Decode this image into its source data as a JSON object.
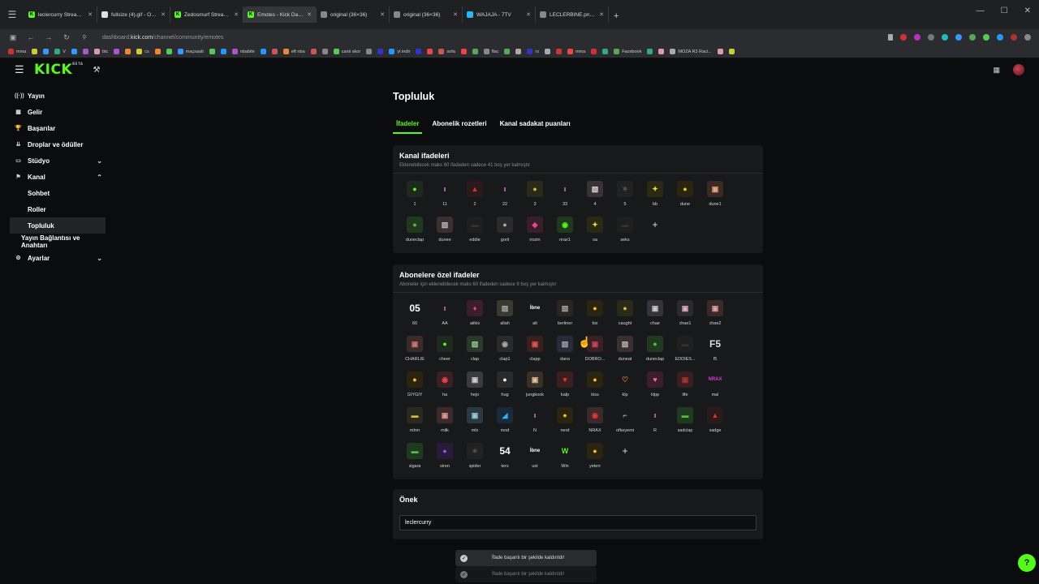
{
  "browser": {
    "tabs": [
      {
        "label": "leclercurry Stream - Watch",
        "fav": "K",
        "color": "#53fc18",
        "active": false
      },
      {
        "label": "fullsize (4).gif - Online GIF...",
        "fav": "",
        "color": "#e0e0e0",
        "active": false
      },
      {
        "label": "Zedosmurf Stream - Watch",
        "fav": "K",
        "color": "#53fc18",
        "active": false
      },
      {
        "label": "Emotes - Kick Dashboard",
        "fav": "K",
        "color": "#53fc18",
        "active": true
      },
      {
        "label": "original (36×36)",
        "fav": "",
        "color": "#888888",
        "active": false
      },
      {
        "label": "original (36×36)",
        "fav": "",
        "color": "#888888",
        "active": false
      },
      {
        "label": "WAJAJA - 7TV",
        "fav": "",
        "color": "#29b6f6",
        "active": false
      },
      {
        "label": "LECLERBINE.png (32×32)",
        "fav": "",
        "color": "#888888",
        "active": false
      }
    ],
    "url_prefix": "dashboard.",
    "url_domain": "kick.com",
    "url_path": "/channel/community/emotes",
    "bookmarks": [
      "mma",
      "V",
      "btc",
      "cs",
      "maçsaati",
      "nbabite",
      "eft nba",
      "canlı skor",
      "yt indir",
      "sofa",
      "flac",
      "rs",
      "mma",
      "Facebook",
      "MOZA R3 Raci..."
    ]
  },
  "header": {
    "logo": "KICK",
    "logo_badge": "BETA"
  },
  "sidebar": {
    "items": [
      {
        "label": "Yayın",
        "icon": "((·))"
      },
      {
        "label": "Gelir",
        "icon": "▦"
      },
      {
        "label": "Başarılar",
        "icon": "🏆"
      },
      {
        "label": "Droplar ve ödüller",
        "icon": "⇊"
      },
      {
        "label": "Stüdyo",
        "icon": "▭"
      },
      {
        "label": "Kanal",
        "icon": "⚑"
      },
      {
        "label": "Ayarlar",
        "icon": "⚙"
      }
    ],
    "kanal_sub": [
      "Sohbet",
      "Roller",
      "Topluluk"
    ],
    "extra": "Yayın Bağlantısı ve Anahtarı"
  },
  "main": {
    "title": "Topluluk",
    "tabs": [
      "İfadeler",
      "Abonelik rozetleri",
      "Kanal sadakat puanları"
    ],
    "channel_emotes": {
      "title": "Kanal ifadeleri",
      "subtitle": "Eklenebilecek maks 60 ifadeden sadece 41 boş yer kalmıştır",
      "items": [
        {
          "name": "1",
          "bg": "#1d2a1d",
          "fg": "#53fc18",
          "glyph": "●"
        },
        {
          "name": "11",
          "bg": "#18191b",
          "fg": "#f28bd0",
          "glyph": "ı"
        },
        {
          "name": "2",
          "bg": "#2a1a1a",
          "fg": "#d33",
          "glyph": "▲"
        },
        {
          "name": "22",
          "bg": "#18191b",
          "fg": "#f28bd0",
          "glyph": "ı"
        },
        {
          "name": "3",
          "bg": "#2a2a1a",
          "fg": "#cdbd3a",
          "glyph": "●"
        },
        {
          "name": "33",
          "bg": "#18191b",
          "fg": "#f28bd0",
          "glyph": "ı"
        },
        {
          "name": "4",
          "bg": "#3a3235",
          "fg": "#ddd",
          "glyph": "▧"
        },
        {
          "name": "5",
          "bg": "#222",
          "fg": "#555",
          "glyph": "✶"
        },
        {
          "name": "bb",
          "bg": "#2a2a14",
          "fg": "#e8d93a",
          "glyph": "✦"
        },
        {
          "name": "dune",
          "bg": "#2a2410",
          "fg": "#f0c419",
          "glyph": "●"
        },
        {
          "name": "dune1",
          "bg": "#3b2a22",
          "fg": "#e6a88a",
          "glyph": "▣"
        },
        {
          "name": "duneclap",
          "bg": "#1f3a1f",
          "fg": "#5fb84a",
          "glyph": "●"
        },
        {
          "name": "dunee",
          "bg": "#3a3030",
          "fg": "#bbb",
          "glyph": "▨"
        },
        {
          "name": "eddie",
          "bg": "#1f1f1f",
          "fg": "#333",
          "glyph": "▬"
        },
        {
          "name": "goril",
          "bg": "#2a2a2a",
          "fg": "#aaa",
          "glyph": "●"
        },
        {
          "name": "irozin",
          "bg": "#3a1f2a",
          "fg": "#e54a9a",
          "glyph": "◆"
        },
        {
          "name": "nrax1",
          "bg": "#1d3a1d",
          "fg": "#53fc18",
          "glyph": "◉"
        },
        {
          "name": "sa",
          "bg": "#2a2a14",
          "fg": "#e8d93a",
          "glyph": "✦"
        },
        {
          "name": "seks",
          "bg": "#1f1f1f",
          "fg": "#333",
          "glyph": "▬"
        }
      ]
    },
    "sub_emotes": {
      "title": "Abonelere özel ifadeler",
      "subtitle": "Aboneler için eklenebilecek maks 60 ifadeden sadece 9 boş yer kalmıştır",
      "items": [
        {
          "name": "60",
          "bg": "#18191b",
          "fg": "#fff",
          "glyph": "05"
        },
        {
          "name": "AA",
          "bg": "#18191b",
          "fg": "#f28bd0",
          "glyph": "ı"
        },
        {
          "name": "aiikis",
          "bg": "#3a1f2a",
          "fg": "#e54a7a",
          "glyph": "♦"
        },
        {
          "name": "allah",
          "bg": "#3a3a30",
          "fg": "#aaa",
          "glyph": "▨"
        },
        {
          "name": "alt",
          "bg": "#18191b",
          "fg": "#fff",
          "glyph": "İbne"
        },
        {
          "name": "berliner",
          "bg": "#2a2520",
          "fg": "#aaa",
          "glyph": "▧"
        },
        {
          "name": "biz",
          "bg": "#2a2410",
          "fg": "#f0c419",
          "glyph": "●"
        },
        {
          "name": "caught",
          "bg": "#2a2a1a",
          "fg": "#cdbd3a",
          "glyph": "●"
        },
        {
          "name": "chae",
          "bg": "#34343a",
          "fg": "#ccc",
          "glyph": "▣"
        },
        {
          "name": "chae1",
          "bg": "#2a2a30",
          "fg": "#e0b0c0",
          "glyph": "▣"
        },
        {
          "name": "chae2",
          "bg": "#3a2a2a",
          "fg": "#e0a0a0",
          "glyph": "▣"
        },
        {
          "name": "CHARLIE",
          "bg": "#3a2a2a",
          "fg": "#c77",
          "glyph": "▣"
        },
        {
          "name": "cheer",
          "bg": "#1d2a1d",
          "fg": "#53fc18",
          "glyph": "●"
        },
        {
          "name": "clap",
          "bg": "#2a3a2a",
          "fg": "#9c9",
          "glyph": "▨"
        },
        {
          "name": "clap1",
          "bg": "#2a2a2a",
          "fg": "#aaa",
          "glyph": "◉"
        },
        {
          "name": "clapp",
          "bg": "#3a1f1f",
          "fg": "#d55",
          "glyph": "▣"
        },
        {
          "name": "dans",
          "bg": "#2a2a3a",
          "fg": "#aaa",
          "glyph": "▧"
        },
        {
          "name": "DOBRO...",
          "bg": "#3a1f24",
          "fg": "#c45",
          "glyph": "▣"
        },
        {
          "name": "duneat",
          "bg": "#3a3030",
          "fg": "#bbb",
          "glyph": "▨"
        },
        {
          "name": "duneclap",
          "bg": "#1f3a1f",
          "fg": "#5fb84a",
          "glyph": "●"
        },
        {
          "name": "EDDIES...",
          "bg": "#1f1f1f",
          "fg": "#333",
          "glyph": "▬"
        },
        {
          "name": "f5",
          "bg": "#18191b",
          "fg": "#ddd",
          "glyph": "F5"
        },
        {
          "name": "GIYGIY",
          "bg": "#2a2410",
          "fg": "#f0c419",
          "glyph": "●"
        },
        {
          "name": "ha",
          "bg": "#3a1f24",
          "fg": "#e44",
          "glyph": "◉"
        },
        {
          "name": "hejo",
          "bg": "#3a3a3f",
          "fg": "#ccc",
          "glyph": "▣"
        },
        {
          "name": "hug",
          "bg": "#2a2a2a",
          "fg": "#eee",
          "glyph": "●"
        },
        {
          "name": "jungkook",
          "bg": "#3a3028",
          "fg": "#e0c0a0",
          "glyph": "▣"
        },
        {
          "name": "kalp",
          "bg": "#3a1f1f",
          "fg": "#e33",
          "glyph": "♥"
        },
        {
          "name": "kiss",
          "bg": "#2a2410",
          "fg": "#f0c419",
          "glyph": "●"
        },
        {
          "name": "klp",
          "bg": "#18191b",
          "fg": "#e8873a",
          "glyph": "♡"
        },
        {
          "name": "klpp",
          "bg": "#3a1f2a",
          "fg": "#f06a9a",
          "glyph": "♥"
        },
        {
          "name": "life",
          "bg": "#3a1f1f",
          "fg": "#a33",
          "glyph": "▣"
        },
        {
          "name": "mal",
          "bg": "#18191b",
          "fg": "#d33fd0",
          "glyph": "NRAX"
        },
        {
          "name": "mhm",
          "bg": "#2a2a20",
          "fg": "#cdbd3a",
          "glyph": "▬"
        },
        {
          "name": "milk",
          "bg": "#3a2a2a",
          "fg": "#d99",
          "glyph": "▣"
        },
        {
          "name": "mlx",
          "bg": "#2a3a3f",
          "fg": "#9cd",
          "glyph": "▣"
        },
        {
          "name": "mod",
          "bg": "#1a2a3a",
          "fg": "#29b6f6",
          "glyph": "◢"
        },
        {
          "name": "N",
          "bg": "#18191b",
          "fg": "#f28bd0",
          "glyph": "ı"
        },
        {
          "name": "nerd",
          "bg": "#2a2410",
          "fg": "#e8c419",
          "glyph": "●"
        },
        {
          "name": "NRAX",
          "bg": "#3a2a2a",
          "fg": "#e33",
          "glyph": "◉"
        },
        {
          "name": "ofkeyemi",
          "bg": "#18191b",
          "fg": "#ddd",
          "glyph": "⌐"
        },
        {
          "name": "R",
          "bg": "#18191b",
          "fg": "#f28bd0",
          "glyph": "ı"
        },
        {
          "name": "sadclap",
          "bg": "#1f3a1f",
          "fg": "#5fb84a",
          "glyph": "▬"
        },
        {
          "name": "sadge",
          "bg": "#2a1a1a",
          "fg": "#d33",
          "glyph": "▲"
        },
        {
          "name": "sigara",
          "bg": "#1f3a1f",
          "fg": "#5fb84a",
          "glyph": "▬"
        },
        {
          "name": "siren",
          "bg": "#2a1a3a",
          "fg": "#8a5af0",
          "glyph": "●"
        },
        {
          "name": "spider",
          "bg": "#222",
          "fg": "#555",
          "glyph": "✶"
        },
        {
          "name": "ters",
          "bg": "#18191b",
          "fg": "#fff",
          "glyph": "54"
        },
        {
          "name": "ust",
          "bg": "#18191b",
          "fg": "#fff",
          "glyph": "İbne"
        },
        {
          "name": "Win",
          "bg": "#18191b",
          "fg": "#53fc18",
          "glyph": "W"
        },
        {
          "name": "yeterr",
          "bg": "#2a2410",
          "fg": "#f0c419",
          "glyph": "●"
        }
      ]
    },
    "prefix": {
      "title": "Önek",
      "value": "leclercurry"
    }
  },
  "toasts": [
    "İfade başarılı bir şekilde kaldırıldı!",
    "İfade başarılı bir şekilde kaldırıldı!"
  ],
  "colors": {
    "accent": "#53fc18",
    "bg": "#0b0c0d",
    "card": "#18191b"
  }
}
